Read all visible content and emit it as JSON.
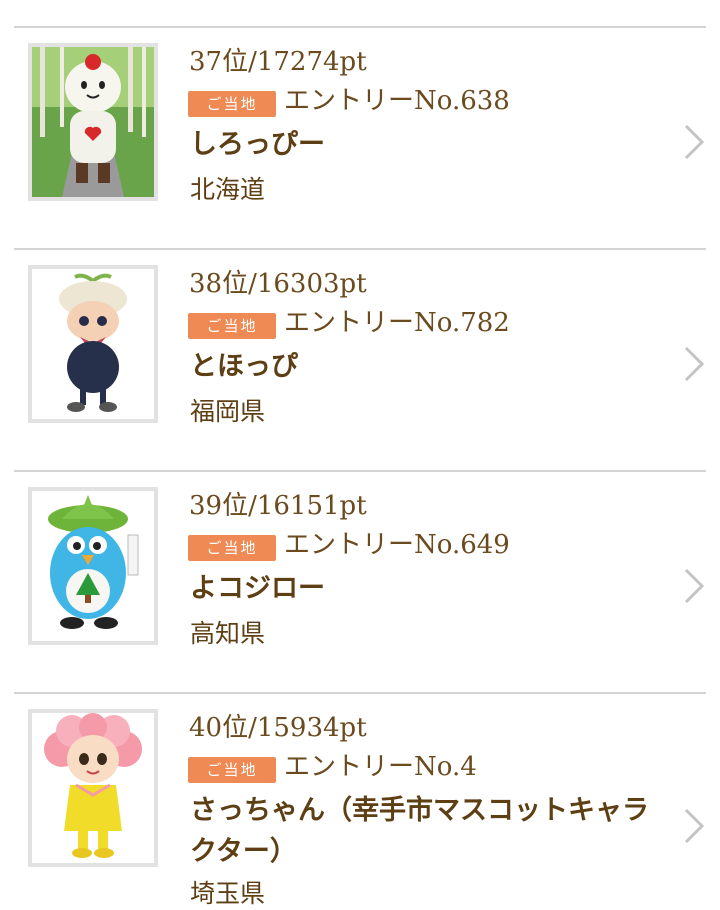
{
  "items": [
    {
      "rank_text": "37位/17274pt",
      "badge": "ご当地",
      "entry": "エントリーNo.638",
      "name": "しろっぴー",
      "prefecture": "北海道",
      "thumb_icon": "shiroppi-mascot-photo"
    },
    {
      "rank_text": "38位/16303pt",
      "badge": "ご当地",
      "entry": "エントリーNo.782",
      "name": "とほっぴ",
      "prefecture": "福岡県",
      "thumb_icon": "tohoppi-mascot-photo"
    },
    {
      "rank_text": "39位/16151pt",
      "badge": "ご当地",
      "entry": "エントリーNo.649",
      "name": "よコジロー",
      "prefecture": "高知県",
      "thumb_icon": "yokojiro-mascot-photo"
    },
    {
      "rank_text": "40位/15934pt",
      "badge": "ご当地",
      "entry": "エントリーNo.4",
      "name": "さっちゃん（幸手市マスコットキャラクター）",
      "prefecture": "埼玉県",
      "thumb_icon": "sacchan-mascot-photo"
    }
  ],
  "colors": {
    "badge": "#ef8a54",
    "text": "#5e3f14",
    "divider": "#d4d4d4",
    "chevron": "#c4c4c4"
  }
}
